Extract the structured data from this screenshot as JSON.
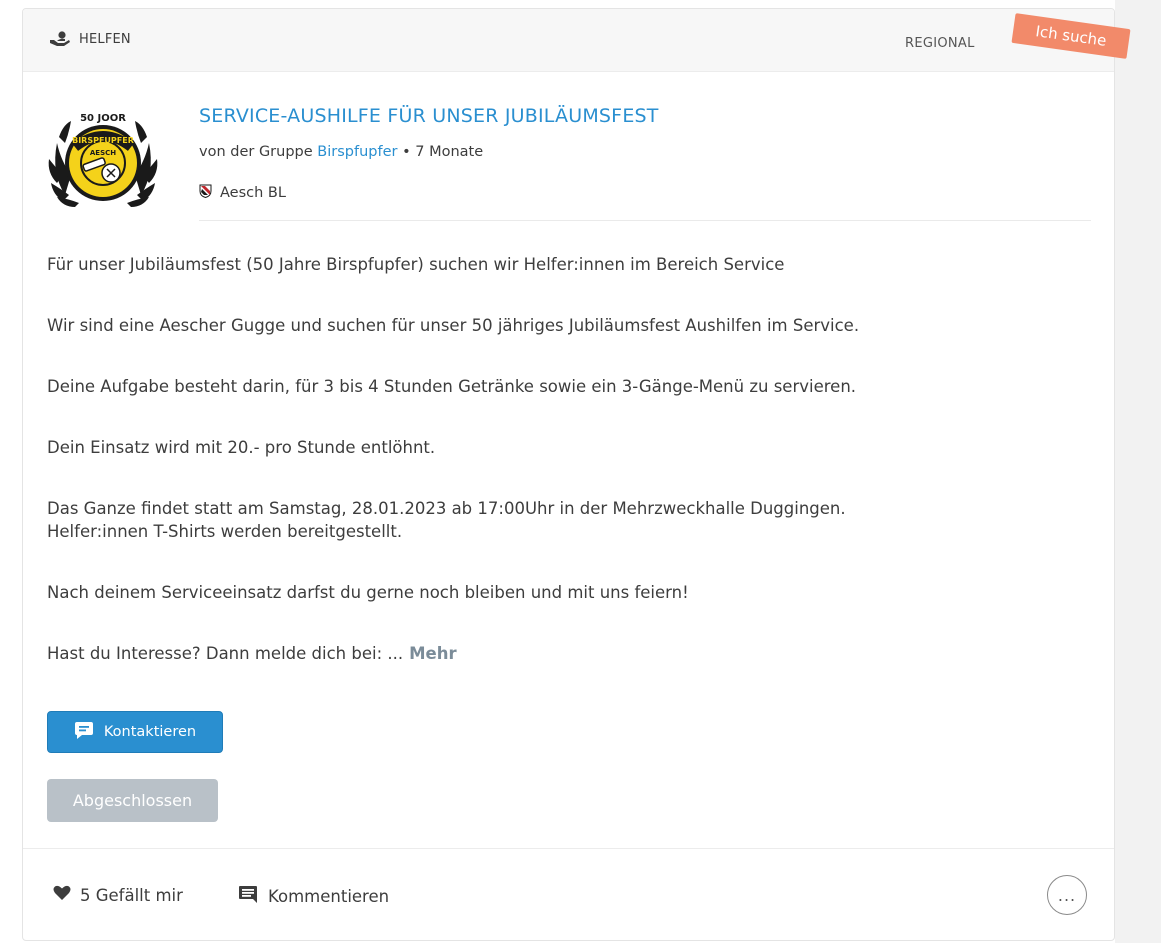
{
  "header": {
    "category": "HELFEN",
    "scope": "REGIONAL",
    "ribbon": "Ich suche"
  },
  "post": {
    "title": "SERVICE-AUSHILFE FÜR UNSER JUBILÄUMSFEST",
    "meta_prefix": "von der Gruppe",
    "group": "Birspfupfer",
    "meta_suffix": " • 7 Monate",
    "location": "Aesch BL",
    "logo_text_top": "50 JOOR",
    "logo_text_band": "BIRSPFUPFER",
    "logo_text_center": "AESCH",
    "paragraphs": [
      "Für unser Jubiläumsfest (50 Jahre Birspfupfer) suchen wir Helfer:innen im Bereich Service",
      "Wir sind eine Aescher Gugge und suchen für unser 50 jähriges Jubiläumsfest Aushilfen im Service.",
      "Deine Aufgabe besteht darin, für 3 bis 4 Stunden Getränke sowie ein 3-Gänge-Menü zu servieren.",
      "Dein Einsatz wird mit 20.- pro Stunde entlöhnt.",
      "Das Ganze findet statt am Samstag, 28.01.2023 ab 17:00Uhr in der Mehrzweckhalle Duggingen.",
      "Helfer:innen T-Shirts werden bereitgestellt.",
      "Nach deinem Serviceeinsatz darfst du gerne noch bleiben und mit uns feiern!",
      "Hast du Interesse? Dann melde dich bei: ..."
    ],
    "more_label": "Mehr"
  },
  "actions": {
    "contact_label": "Kontaktieren",
    "closed_label": "Abgeschlossen"
  },
  "footer": {
    "likes_label": "5 Gefällt mir",
    "comment_label": "Kommentieren",
    "more_options": "..."
  },
  "colors": {
    "accent": "#2a8fd0",
    "ribbon": "#f28a6a",
    "disabled": "#b9c1c8"
  }
}
